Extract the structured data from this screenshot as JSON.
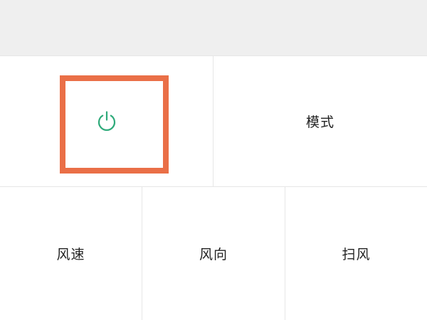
{
  "controls": {
    "power": {
      "icon": "power-icon",
      "color": "#2eaa7a"
    },
    "mode": {
      "label": "模式"
    },
    "fan_speed": {
      "label": "风速"
    },
    "wind_direction": {
      "label": "风向"
    },
    "swing": {
      "label": "扫风"
    }
  },
  "highlight": {
    "color": "#ea6f47",
    "target": "power"
  }
}
